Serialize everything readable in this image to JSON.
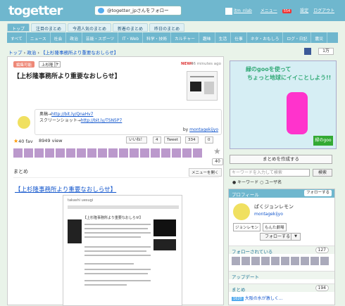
{
  "header": {
    "logo": "togetter",
    "follow_label": "@togetter_jpさんをフォロー",
    "user": "itm_nlab",
    "menu": "メニュー",
    "menu_badge": "554",
    "settings": "設定",
    "logout": "ログアウト"
  },
  "tabs1": [
    "トップ",
    "注目のまとめ",
    "今週人気のまとめ",
    "新着のまとめ",
    "昨日のまとめ"
  ],
  "tabs2": [
    "すべて",
    "ニュース",
    "社会",
    "政治",
    "芸能・スポーツ",
    "IT・Web",
    "科学・技術",
    "カルチャー",
    "趣味",
    "生活",
    "仕事",
    "ネタ・おもしろ",
    "ログ・日記",
    "震災"
  ],
  "breadcrumb": {
    "home": "トップ",
    "sep1": "›",
    "cat": "政治",
    "sep2": "›",
    "current": "【上杉隆事務所より重要なおしらせ】"
  },
  "fb_count": "1万",
  "article": {
    "edit_label": "編集可能",
    "category": "上杉隆",
    "plus": "+",
    "new_label": "NEW!",
    "ago": "46 minutes ago",
    "title": "【上杉隆事務所より重要なおしらせ】",
    "source_label": "奥稿→",
    "source_url": "http://bit.ly/QnaHv7",
    "screenshot_label": "スクリーンショット→",
    "screenshot_url": "http://bit.ly/TSN5P7",
    "by": "by",
    "author": "montagekijyo",
    "fav": "40 fav",
    "views": "8949 view",
    "like": "いいね！",
    "like_count": "4",
    "tweet": "Tweet",
    "tweet_count": "334",
    "b_count": "0",
    "star_count": "40",
    "matome": "まとめ",
    "menu_btn": "メニューを開く",
    "subtitle": "【上杉隆事務所より重要なおしらせ】"
  },
  "docimage": {
    "site": "takashi uesugi",
    "title": "【上杉隆事務所より重要なおしらせ】"
  },
  "sidebar": {
    "ad_line1": "緑のgooを使って",
    "ad_line2": "ちょっと地球にイイことしよう!!",
    "ad_logo": "緑のgoo",
    "create_label": "まとめを作成する",
    "search_placeholder": "キーワードを入力して検索",
    "search_btn": "検索",
    "radio_keyword": "キーワード",
    "radio_user": "ユーザ名",
    "profile_header": "プロフィール",
    "profile_follow": "フォローする",
    "profile_name": "ぱくジョンレモン",
    "profile_user": "montagekijyo",
    "tag1": "ジョンレモン",
    "tag2": "もんた劇場",
    "follow_btn": "フォローする",
    "followers_label": "フォローされている",
    "followers_count": "127",
    "updates_label": "アップデート",
    "matome_label": "まとめ",
    "matome_count": "194",
    "recent_badge": "1620",
    "recent_text": "大阪の水が激しく..."
  }
}
